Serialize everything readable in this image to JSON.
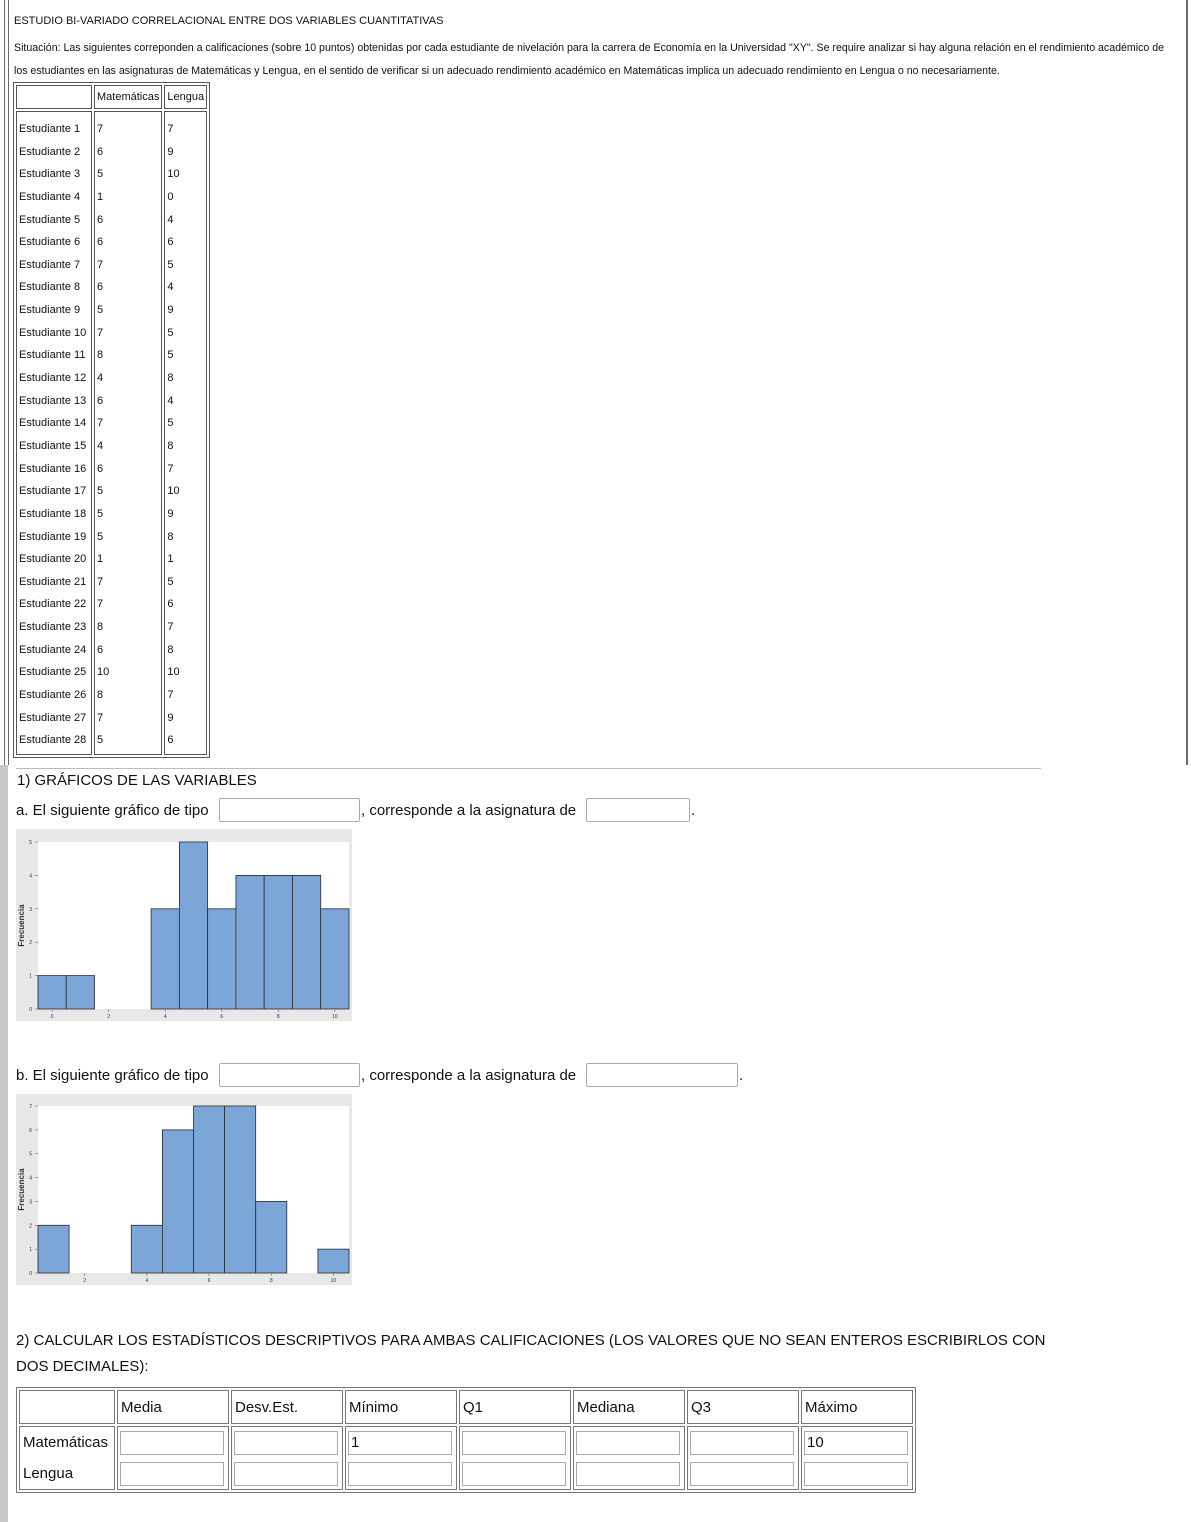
{
  "header": {
    "title": "ESTUDIO BI-VARIADO CORRELACIONAL ENTRE DOS VARIABLES CUANTITATIVAS",
    "situation": "Situación: Las siguientes correponden a calificaciones (sobre 10 puntos) obtenidas por cada estudiante de nivelación para la carrera de Economía en la Universidad \"XY\". Se require analizar si hay alguna relación en el rendimiento académico de los estudiantes en las asignaturas de Matemáticas y Lengua, en el sentido de verificar si un adecuado rendimiento académico en Matemáticas implica un adecuado rendimiento en Lengua o no necesariamente."
  },
  "data_table": {
    "headers": [
      "",
      "Matemáticas",
      "Lengua"
    ],
    "rows": [
      [
        "Estudiante 1",
        "7",
        "7"
      ],
      [
        "Estudiante 2",
        "6",
        "9"
      ],
      [
        "Estudiante 3",
        "5",
        "10"
      ],
      [
        "Estudiante 4",
        "1",
        "0"
      ],
      [
        "Estudiante 5",
        "6",
        "4"
      ],
      [
        "Estudiante 6",
        "6",
        "6"
      ],
      [
        "Estudiante 7",
        "7",
        "5"
      ],
      [
        "Estudiante 8",
        "6",
        "4"
      ],
      [
        "Estudiante 9",
        "5",
        "9"
      ],
      [
        "Estudiante 10",
        "7",
        "5"
      ],
      [
        "Estudiante 11",
        "8",
        "5"
      ],
      [
        "Estudiante 12",
        "4",
        "8"
      ],
      [
        "Estudiante 13",
        "6",
        "4"
      ],
      [
        "Estudiante 14",
        "7",
        "5"
      ],
      [
        "Estudiante 15",
        "4",
        "8"
      ],
      [
        "Estudiante 16",
        "6",
        "7"
      ],
      [
        "Estudiante 17",
        "5",
        "10"
      ],
      [
        "Estudiante 18",
        "5",
        "9"
      ],
      [
        "Estudiante 19",
        "5",
        "8"
      ],
      [
        "Estudiante 20",
        "1",
        "1"
      ],
      [
        "Estudiante 21",
        "7",
        "5"
      ],
      [
        "Estudiante 22",
        "7",
        "6"
      ],
      [
        "Estudiante 23",
        "8",
        "7"
      ],
      [
        "Estudiante 24",
        "6",
        "8"
      ],
      [
        "Estudiante 25",
        "10",
        "10"
      ],
      [
        "Estudiante 26",
        "8",
        "7"
      ],
      [
        "Estudiante 27",
        "7",
        "9"
      ],
      [
        "Estudiante 28",
        "5",
        "6"
      ]
    ]
  },
  "section1": {
    "title": "1) GRÁFICOS DE LAS VARIABLES",
    "a": {
      "prefix": "a. El siguiente gráfico de tipo",
      "middle": ", corresponde a la asignatura de",
      "suffix": ".",
      "type_value": "",
      "subject_value": ""
    },
    "b": {
      "prefix": "b. El siguiente gráfico de tipo",
      "middle": ", corresponde a la asignatura de",
      "suffix": ".",
      "type_value": "",
      "subject_value": ""
    }
  },
  "chart_data": [
    {
      "type": "bar",
      "ylabel": "Frecuencia",
      "xlim": [
        -0.5,
        10.5
      ],
      "ylim": [
        0,
        5
      ],
      "xticks": [
        0,
        2,
        4,
        6,
        8,
        10
      ],
      "yticks": [
        0,
        1,
        2,
        3,
        4,
        5
      ],
      "bin_width": 1,
      "bins": [
        {
          "x": 0,
          "count": 1
        },
        {
          "x": 1,
          "count": 1
        },
        {
          "x": 2,
          "count": 0
        },
        {
          "x": 3,
          "count": 0
        },
        {
          "x": 4,
          "count": 3
        },
        {
          "x": 5,
          "count": 5
        },
        {
          "x": 6,
          "count": 3
        },
        {
          "x": 7,
          "count": 4
        },
        {
          "x": 8,
          "count": 4
        },
        {
          "x": 9,
          "count": 4
        },
        {
          "x": 10,
          "count": 3
        }
      ],
      "bar_color": "#7ca5d8"
    },
    {
      "type": "bar",
      "ylabel": "Frecuencia",
      "xlim": [
        0.5,
        10.5
      ],
      "ylim": [
        0,
        7
      ],
      "xticks": [
        2,
        4,
        6,
        8,
        10
      ],
      "yticks": [
        0,
        1,
        2,
        3,
        4,
        5,
        6,
        7
      ],
      "bin_width": 1,
      "bins": [
        {
          "x": 1,
          "count": 2
        },
        {
          "x": 2,
          "count": 0
        },
        {
          "x": 3,
          "count": 0
        },
        {
          "x": 4,
          "count": 2
        },
        {
          "x": 5,
          "count": 6
        },
        {
          "x": 6,
          "count": 7
        },
        {
          "x": 7,
          "count": 7
        },
        {
          "x": 8,
          "count": 3
        },
        {
          "x": 9,
          "count": 0
        },
        {
          "x": 10,
          "count": 1
        }
      ],
      "bar_color": "#7ca5d8"
    }
  ],
  "section2": {
    "title": "2) CALCULAR LOS ESTADÍSTICOS DESCRIPTIVOS PARA AMBAS CALIFICACIONES (LOS VALORES QUE NO SEAN ENTEROS ESCRIBIRLOS CON DOS DECIMALES):",
    "headers": [
      "",
      "Media",
      "Desv.Est.",
      "Mínimo",
      "Q1",
      "Mediana",
      "Q3",
      "Máximo"
    ],
    "rows": [
      {
        "label": "Matemáticas",
        "values": [
          "",
          "",
          "1",
          "",
          "",
          "",
          "10"
        ]
      },
      {
        "label": "Lengua",
        "values": [
          "",
          "",
          "",
          "",
          "",
          "",
          ""
        ]
      }
    ]
  }
}
